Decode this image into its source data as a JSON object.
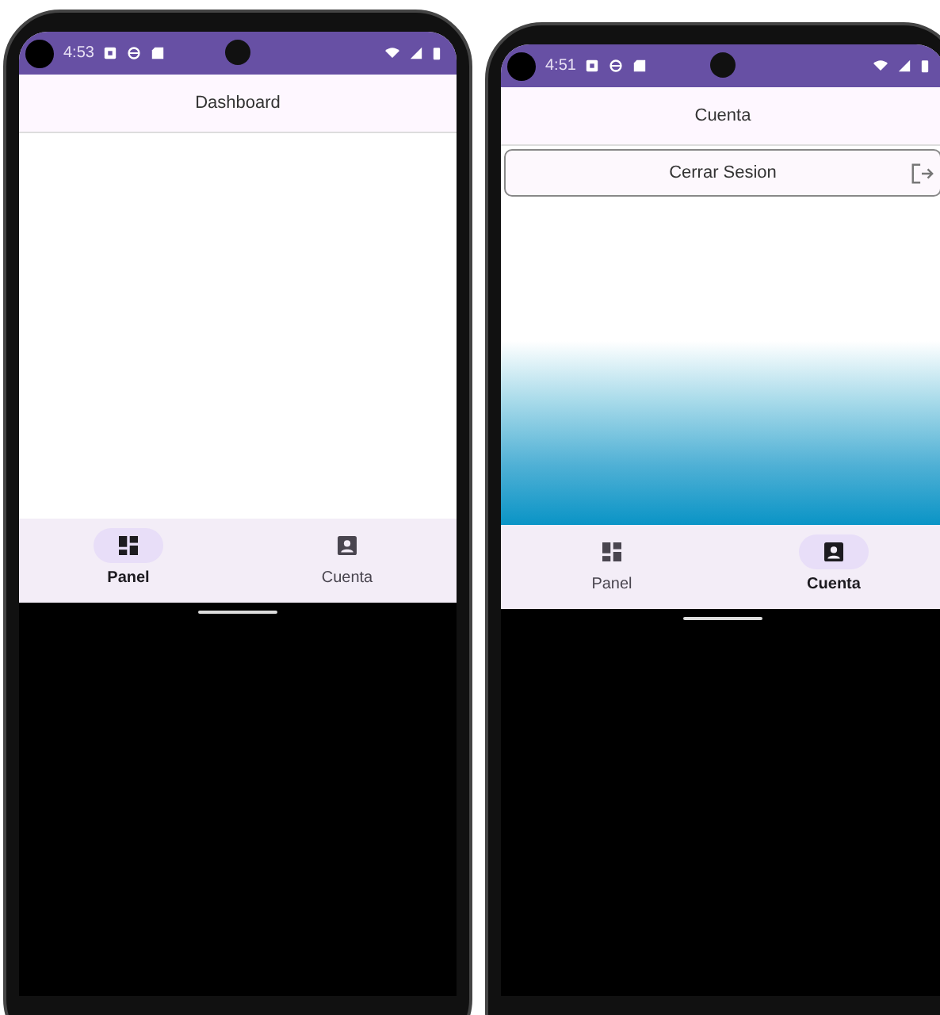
{
  "phones": [
    {
      "status_bar": {
        "time": "4:53"
      },
      "title": "Dashboard",
      "content": {
        "kind": "blank"
      },
      "nav": [
        {
          "label": "Panel",
          "kind": "dashboard",
          "selected": true
        },
        {
          "label": "Cuenta",
          "kind": "account",
          "selected": false
        }
      ]
    },
    {
      "status_bar": {
        "time": "4:51"
      },
      "title": "Cuenta",
      "content": {
        "kind": "account",
        "button": "Cerrar Sesion"
      },
      "nav": [
        {
          "label": "Panel",
          "kind": "dashboard",
          "selected": false
        },
        {
          "label": "Cuenta",
          "kind": "account",
          "selected": true
        }
      ]
    }
  ]
}
